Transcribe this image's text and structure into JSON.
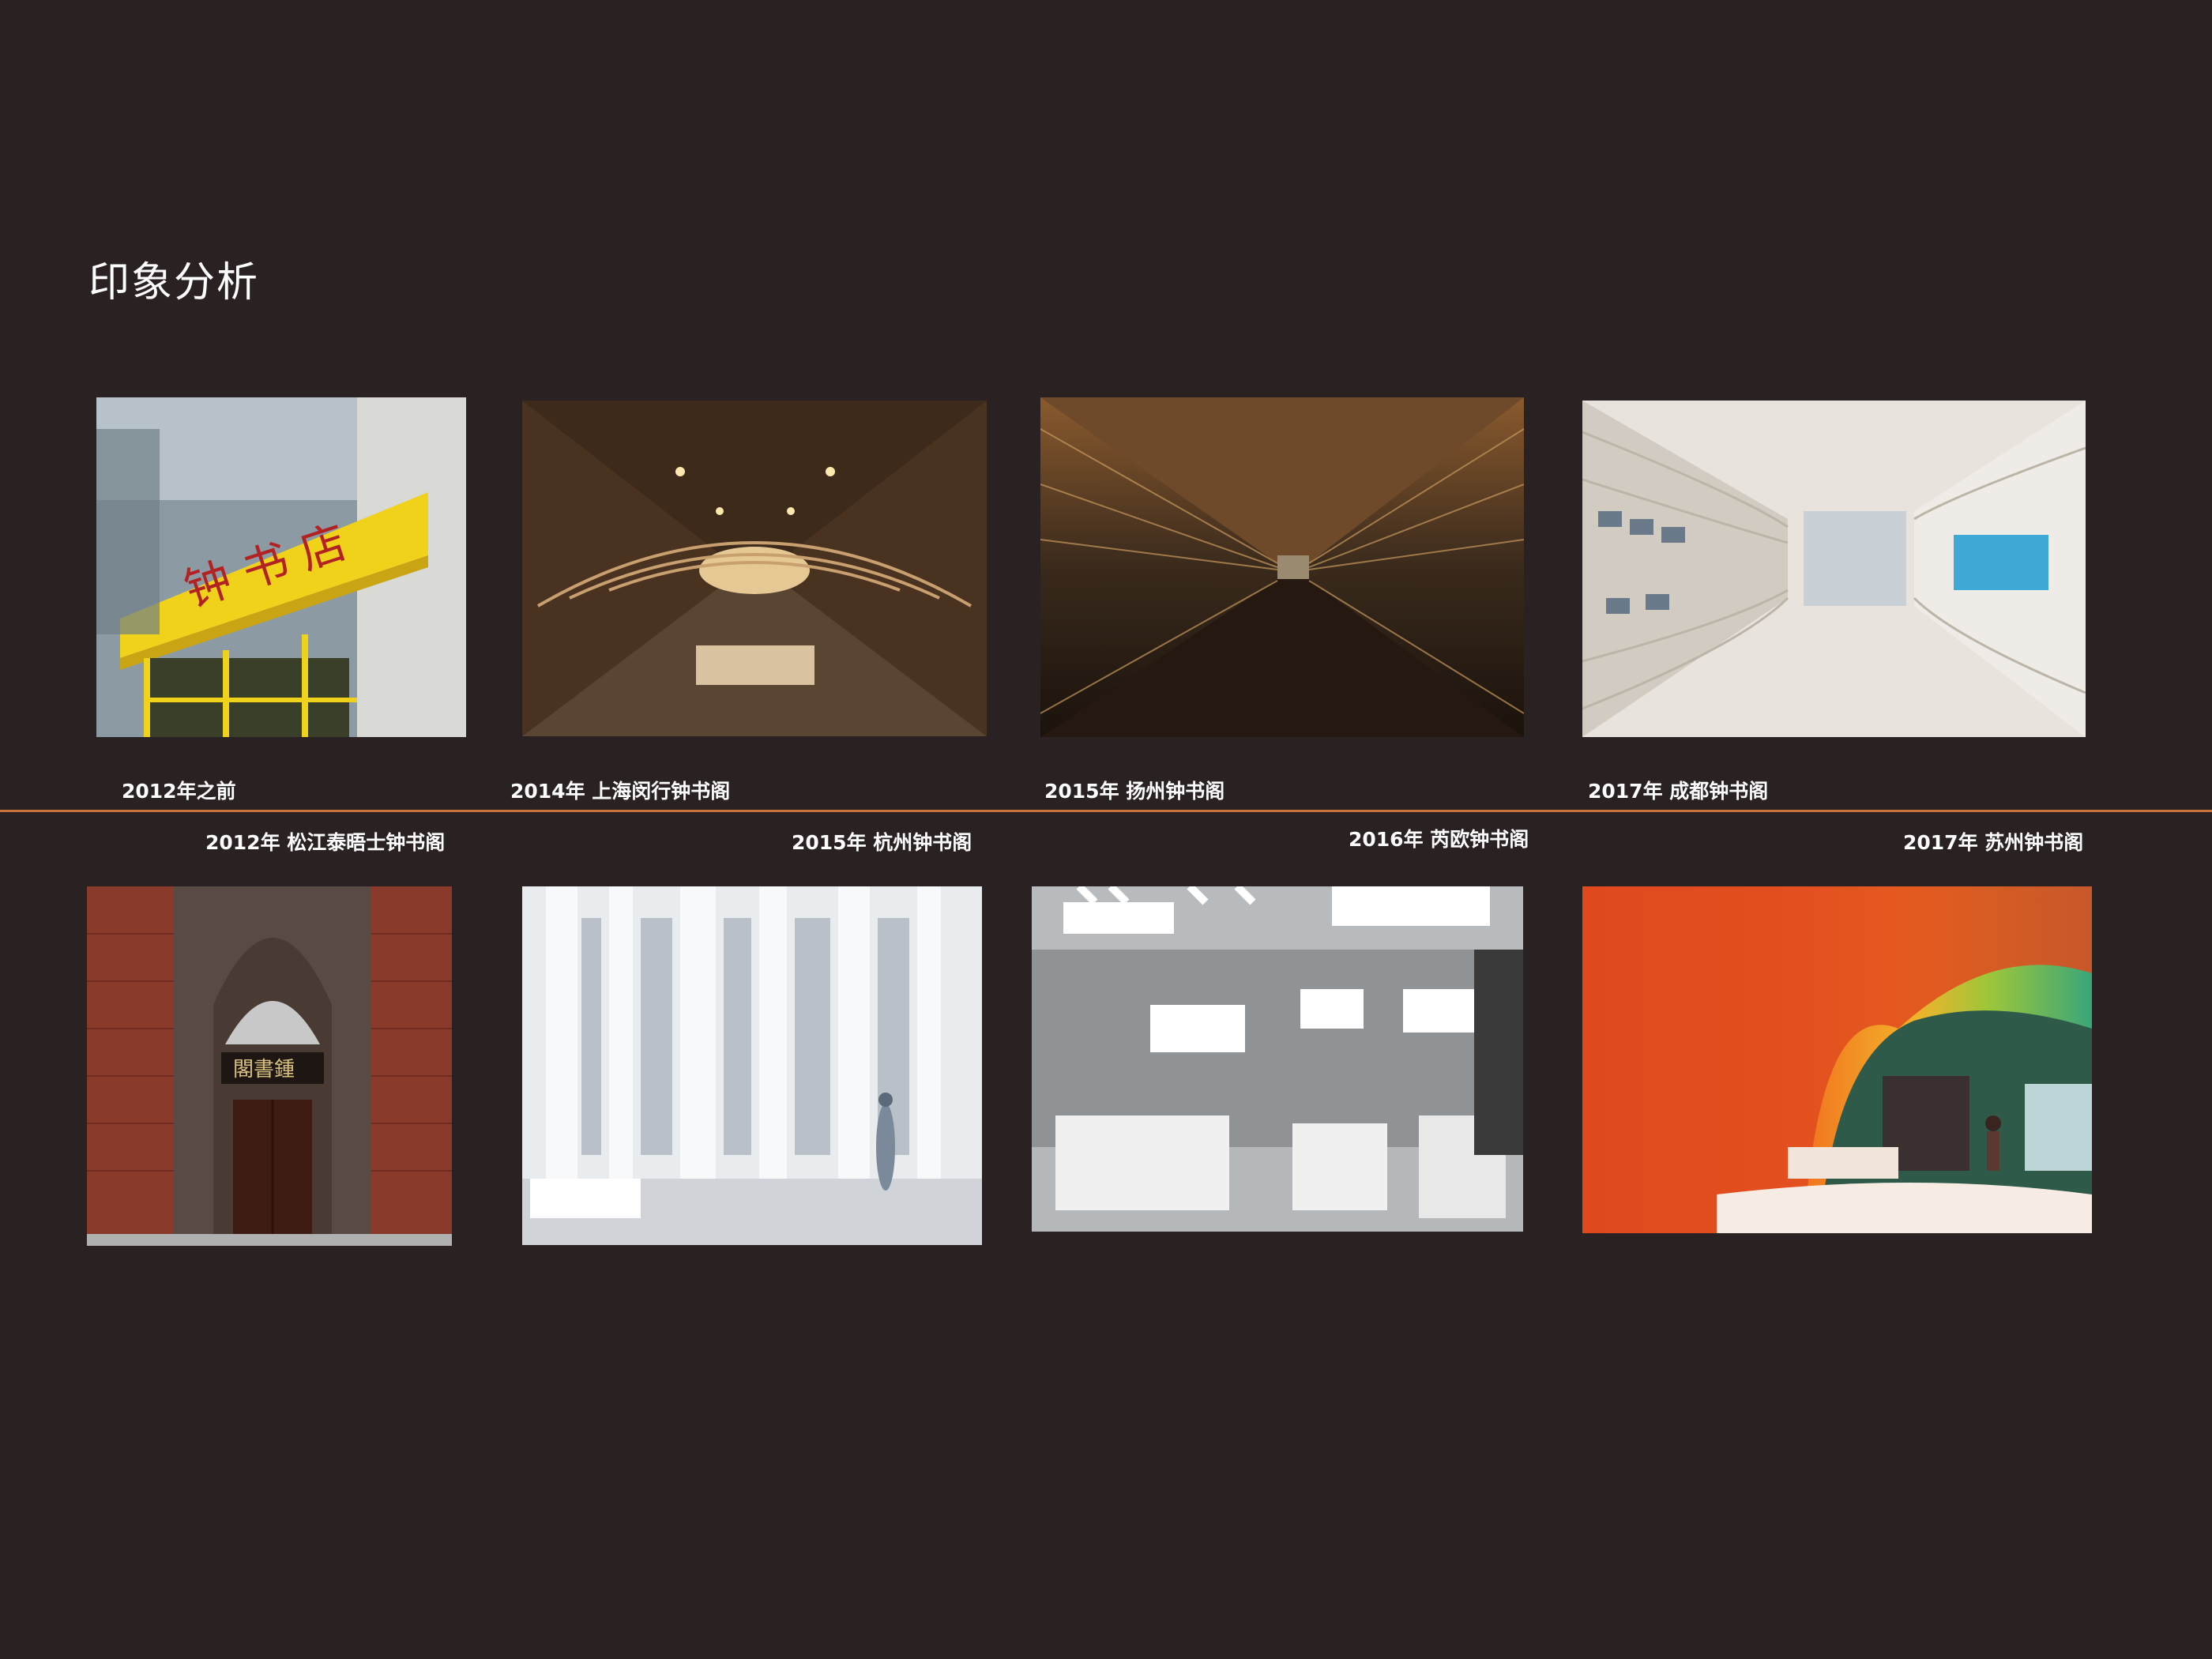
{
  "title": "印象分析",
  "accent_color": "#c9733a",
  "background_color": "#2a2222",
  "row_top": [
    {
      "caption": "2012年之前",
      "photo": "storefront-photo"
    },
    {
      "caption": "2014年 上海闵行钟书阁",
      "photo": "minhang-bookstore-photo"
    },
    {
      "caption": "2015年 扬州钟书阁",
      "photo": "yangzhou-bookstore-photo"
    },
    {
      "caption": "2017年 成都钟书阁",
      "photo": "chengdu-bookstore-photo"
    }
  ],
  "row_bottom": [
    {
      "caption": "2012年 松江泰晤士钟书阁",
      "photo": "songjiang-bookstore-photo"
    },
    {
      "caption": "2015年 杭州钟书阁",
      "photo": "hangzhou-bookstore-photo"
    },
    {
      "caption": "2016年 芮欧钟书阁",
      "photo": "reel-bookstore-photo"
    },
    {
      "caption": "2017年 苏州钟书阁",
      "photo": "suzhou-bookstore-photo"
    }
  ]
}
